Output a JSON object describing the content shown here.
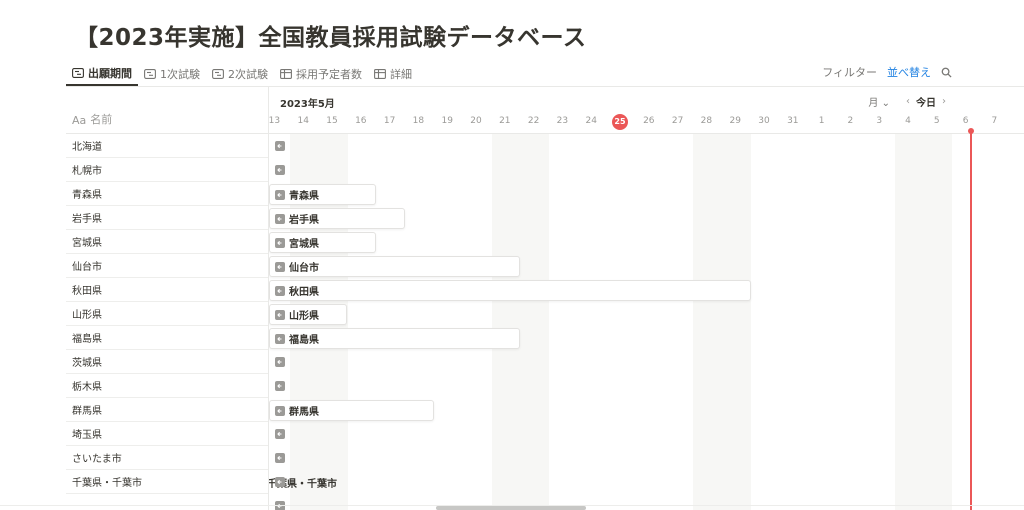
{
  "page": {
    "title": "【2023年実施】全国教員採用試験データベース"
  },
  "views": [
    {
      "label": "出願期間",
      "icon": "timeline-icon",
      "active": true
    },
    {
      "label": "1次試験",
      "icon": "timeline-icon",
      "active": false
    },
    {
      "label": "2次試験",
      "icon": "timeline-icon",
      "active": false
    },
    {
      "label": "採用予定者数",
      "icon": "table-icon",
      "active": false
    },
    {
      "label": "詳細",
      "icon": "table-icon",
      "active": false
    }
  ],
  "toolbar": {
    "filter": "フィルター",
    "sort": "並べ替え",
    "search_icon": "search-icon"
  },
  "table": {
    "name_header_prefix": "Aa",
    "name_header": "名前"
  },
  "timeline": {
    "month_label": "2023年5月",
    "scale": "月",
    "today_label": "今日",
    "today_day": "25",
    "days": [
      "13",
      "14",
      "15",
      "16",
      "17",
      "18",
      "19",
      "20",
      "21",
      "22",
      "23",
      "24",
      "25",
      "26",
      "27",
      "28",
      "29",
      "30",
      "31",
      "1",
      "2",
      "3",
      "4",
      "5",
      "6",
      "7"
    ],
    "weekend_days": [
      "13",
      "14",
      "20",
      "21",
      "27",
      "28",
      "3",
      "4"
    ]
  },
  "rows": [
    {
      "name": "北海道",
      "bar": null
    },
    {
      "name": "札幌市",
      "bar": null
    },
    {
      "name": "青森県",
      "bar": {
        "label": "青森県",
        "start": "13",
        "end": "16"
      }
    },
    {
      "name": "岩手県",
      "bar": {
        "label": "岩手県",
        "start": "13",
        "end": "17"
      }
    },
    {
      "name": "宮城県",
      "bar": {
        "label": "宮城県",
        "start": "13",
        "end": "16"
      }
    },
    {
      "name": "仙台市",
      "bar": {
        "label": "仙台市",
        "start": "13",
        "end": "21"
      }
    },
    {
      "name": "秋田県",
      "bar": {
        "label": "秋田県",
        "start": "13",
        "end": "29"
      }
    },
    {
      "name": "山形県",
      "bar": {
        "label": "山形県",
        "start": "13",
        "end": "15"
      }
    },
    {
      "name": "福島県",
      "bar": {
        "label": "福島県",
        "start": "13",
        "end": "21"
      }
    },
    {
      "name": "茨城県",
      "bar": null
    },
    {
      "name": "栃木県",
      "bar": null
    },
    {
      "name": "群馬県",
      "bar": {
        "label": "群馬県",
        "start": "13",
        "end": "18"
      }
    },
    {
      "name": "埼玉県",
      "bar": null
    },
    {
      "name": "さいたま市",
      "bar": null
    },
    {
      "name": "千葉県・千葉市",
      "bar": null,
      "overflow_label": "千葉県・千葉市"
    },
    {
      "name": "",
      "bar": null
    }
  ]
}
